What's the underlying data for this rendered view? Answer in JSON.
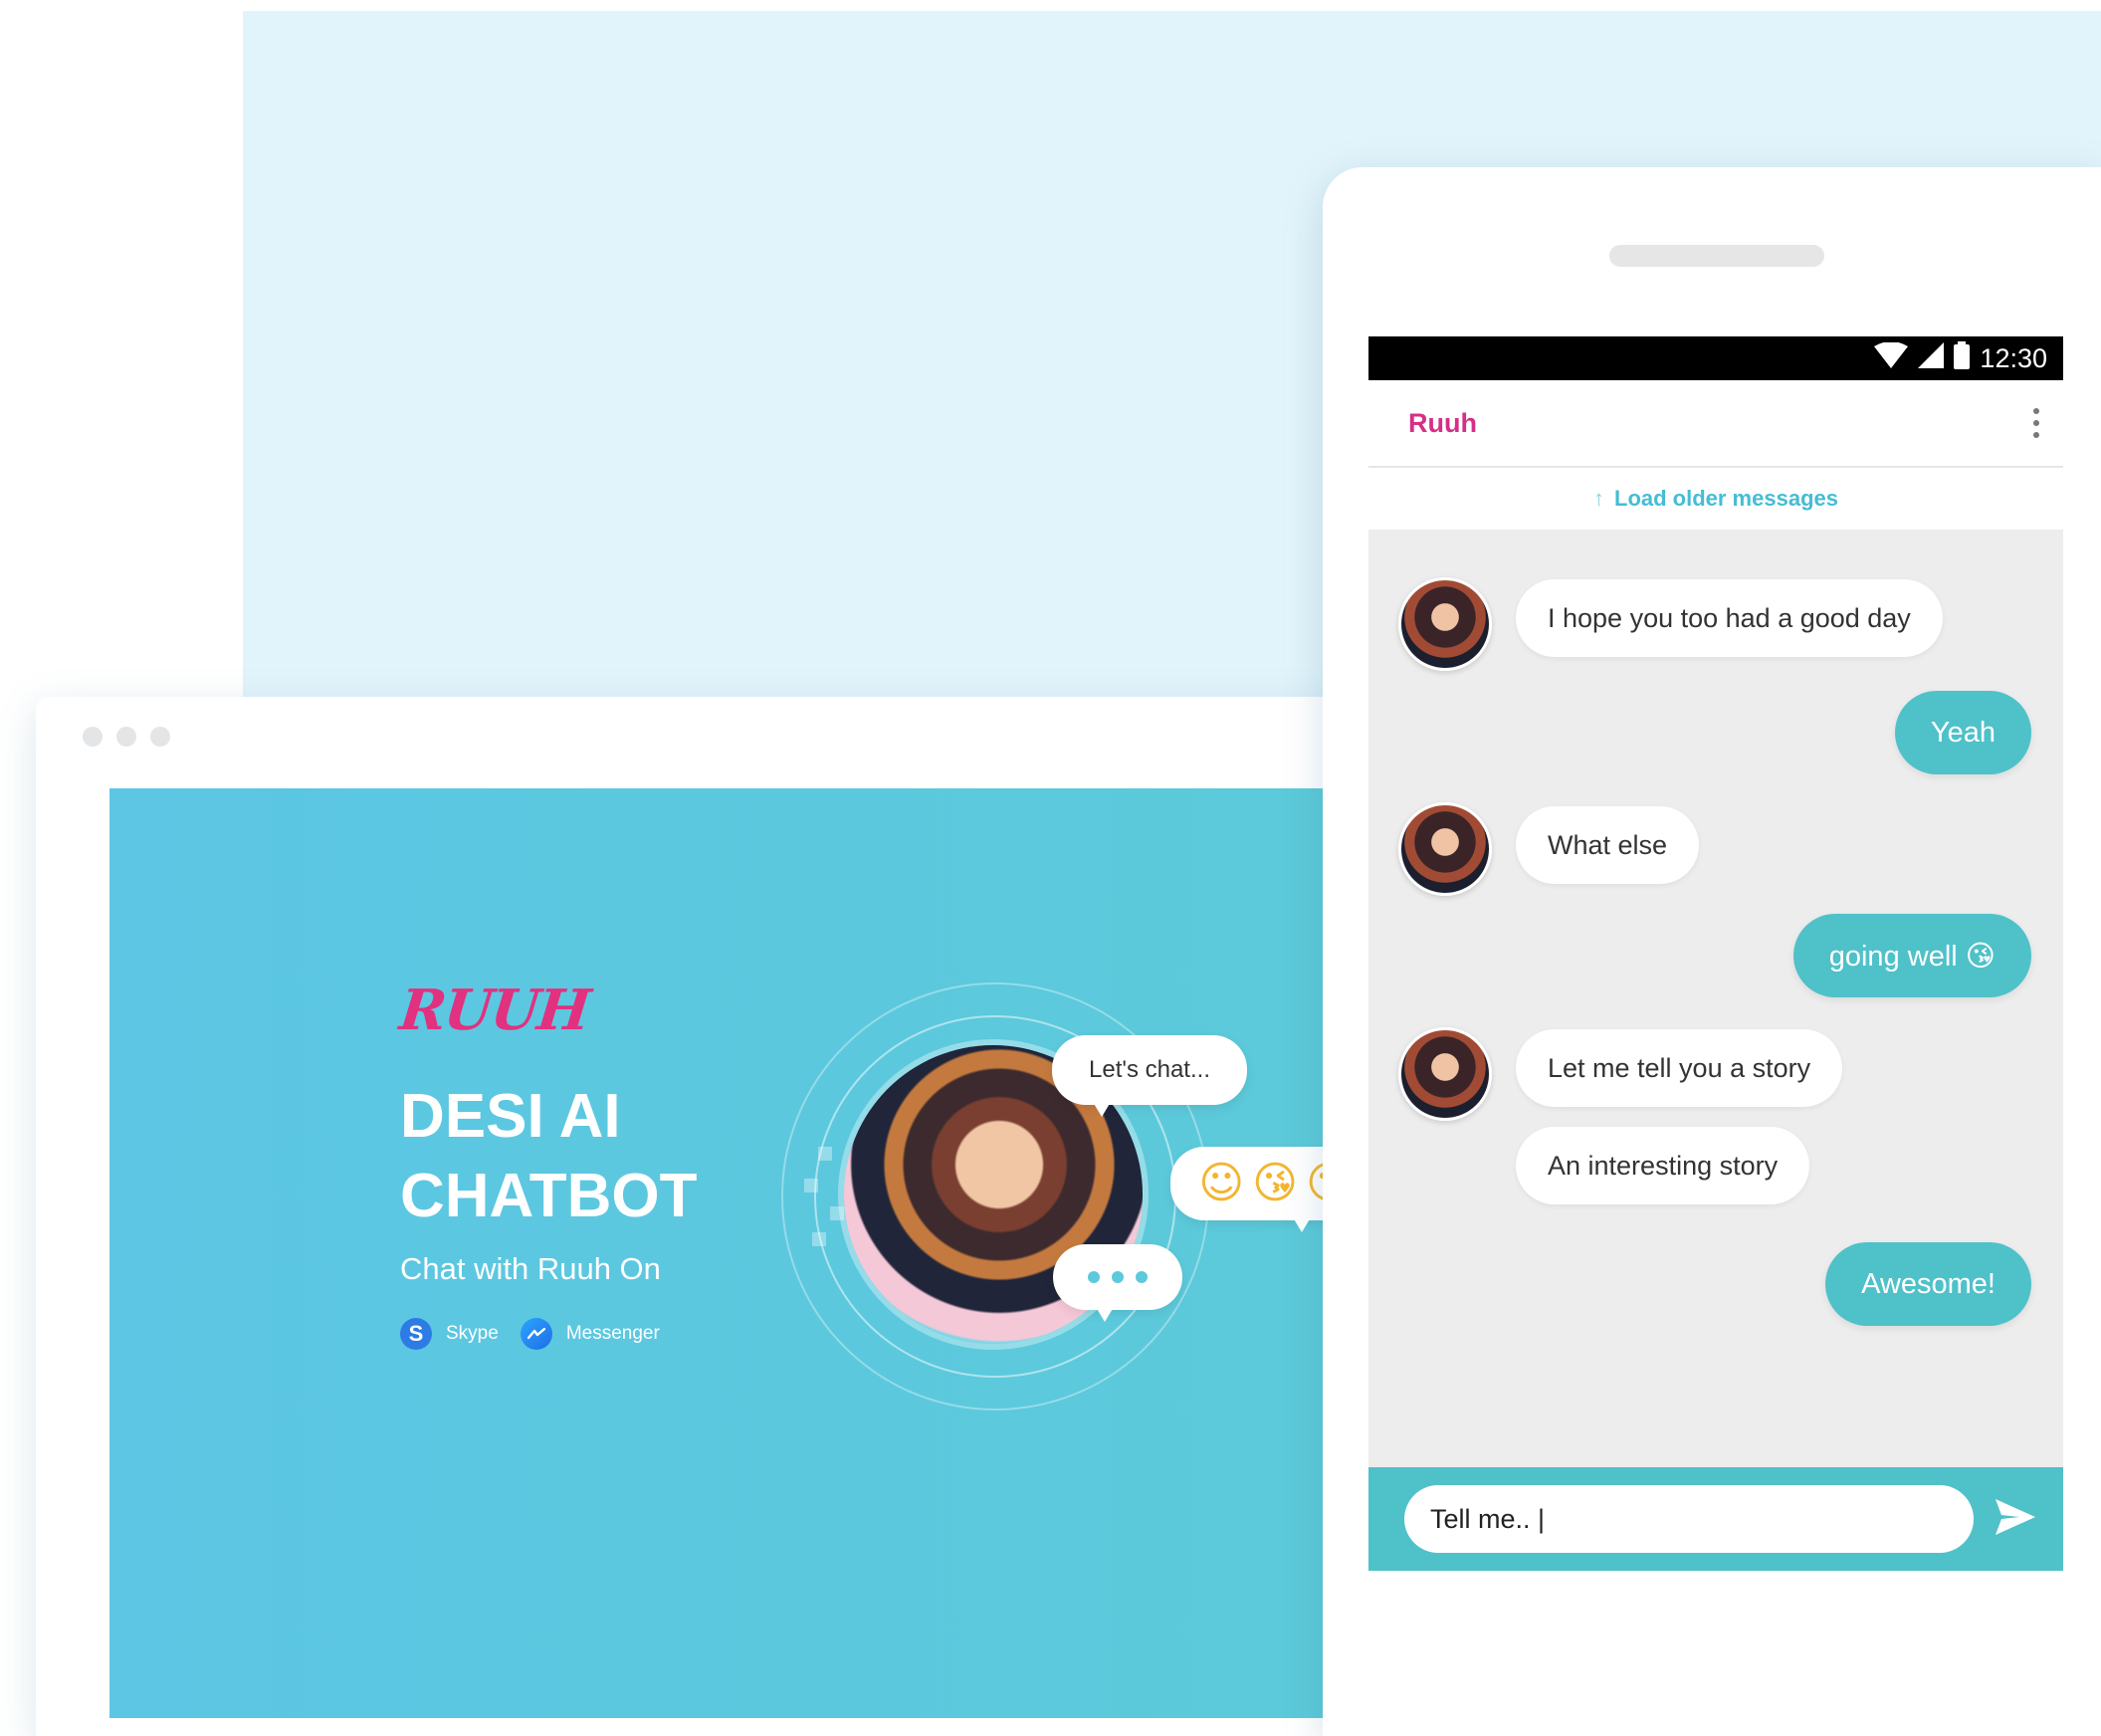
{
  "hero": {
    "brand": "RUUH",
    "headline_line1": "DESI AI",
    "headline_line2": "CHATBOT",
    "subhead": "Chat with Ruuh On",
    "platforms": [
      {
        "label": "Skype",
        "icon": "skype-icon",
        "glyph": "S"
      },
      {
        "label": "Messenger",
        "icon": "messenger-icon",
        "glyph": "~"
      }
    ],
    "bubble_chat": "Let's chat...",
    "emoji_bubble": [
      "☺",
      "😘",
      "😘"
    ]
  },
  "phone": {
    "status": {
      "time": "12:30",
      "icons": [
        "wifi-icon",
        "signal-icon",
        "battery-icon"
      ]
    },
    "title": "Ruuh",
    "load_older": "Load older messages",
    "messages": [
      {
        "from": "bot",
        "text": "I hope you too had a good day"
      },
      {
        "from": "user",
        "text": "Yeah"
      },
      {
        "from": "bot",
        "text": "What else"
      },
      {
        "from": "user",
        "text": "going well 😘"
      },
      {
        "from": "bot",
        "text": "Let me tell you a story"
      },
      {
        "from": "bot",
        "text": "An interesting story"
      },
      {
        "from": "user",
        "text": "Awesome!"
      }
    ],
    "input_value": "Tell me.. |"
  },
  "colors": {
    "accent_pink": "#d62f86",
    "accent_teal": "#4fc1c9",
    "hero_blue": "#5cc6e4",
    "page_bg": "#e2f4fb"
  }
}
